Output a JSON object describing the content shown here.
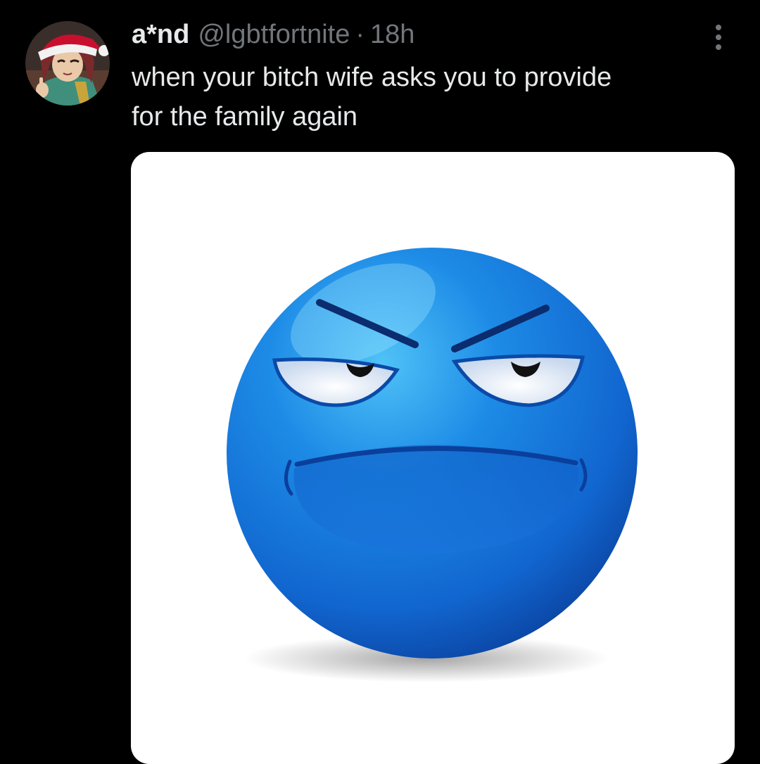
{
  "tweet": {
    "author": {
      "display_name": "a*nd",
      "handle": "@lgbtfortnite",
      "avatar_icon": "cartoon-avatar-santa-hat"
    },
    "separator": "·",
    "timestamp": "18h",
    "more_icon": "more-vertical-icon",
    "text": "when your bitch wife asks you to provide\nfor the family again",
    "media": {
      "type": "image",
      "subject_icon": "annoyed-blue-emoji",
      "background_color": "#ffffff",
      "emoji_color": "#1a72d9"
    }
  },
  "theme": {
    "background": "#000000",
    "text_primary": "#e7e9ea",
    "text_secondary": "#71767b"
  }
}
